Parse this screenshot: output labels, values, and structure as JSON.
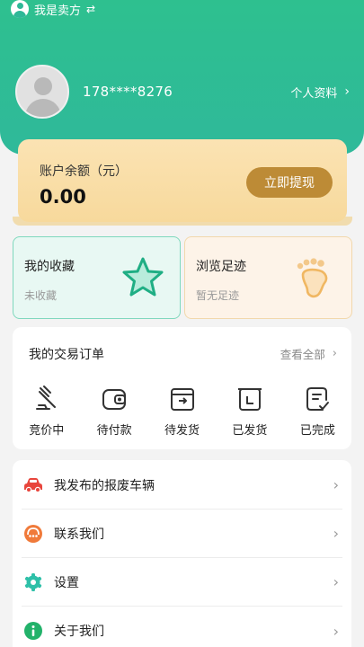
{
  "header": {
    "role_label": "我是卖方",
    "role_switch_icon": "swap-icon",
    "phone": "178****8276",
    "profile_link": "个人资料",
    "accent_color": "#2ec08f"
  },
  "balance": {
    "label": "账户余额（元）",
    "value": "0.00",
    "withdraw_button": "立即提现"
  },
  "quick_links": [
    {
      "title": "我的收藏",
      "subtitle": "未收藏",
      "icon": "star-icon"
    },
    {
      "title": "浏览足迹",
      "subtitle": "暂无足迹",
      "icon": "footprint-icon"
    }
  ],
  "orders": {
    "title": "我的交易订单",
    "view_all": "查看全部",
    "items": [
      {
        "label": "竞价中",
        "icon": "gavel-icon"
      },
      {
        "label": "待付款",
        "icon": "wallet-icon"
      },
      {
        "label": "待发货",
        "icon": "box-ship-icon"
      },
      {
        "label": "已发货",
        "icon": "shipped-icon"
      },
      {
        "label": "已完成",
        "icon": "done-doc-icon"
      }
    ]
  },
  "menu": [
    {
      "label": "我发布的报废车辆",
      "icon": "car-icon",
      "color": "#e8453c"
    },
    {
      "label": "联系我们",
      "icon": "support-icon",
      "color": "#f07a3a"
    },
    {
      "label": "设置",
      "icon": "gear-icon",
      "color": "#2ec0a8"
    },
    {
      "label": "关于我们",
      "icon": "info-icon",
      "color": "#22b26a"
    }
  ]
}
